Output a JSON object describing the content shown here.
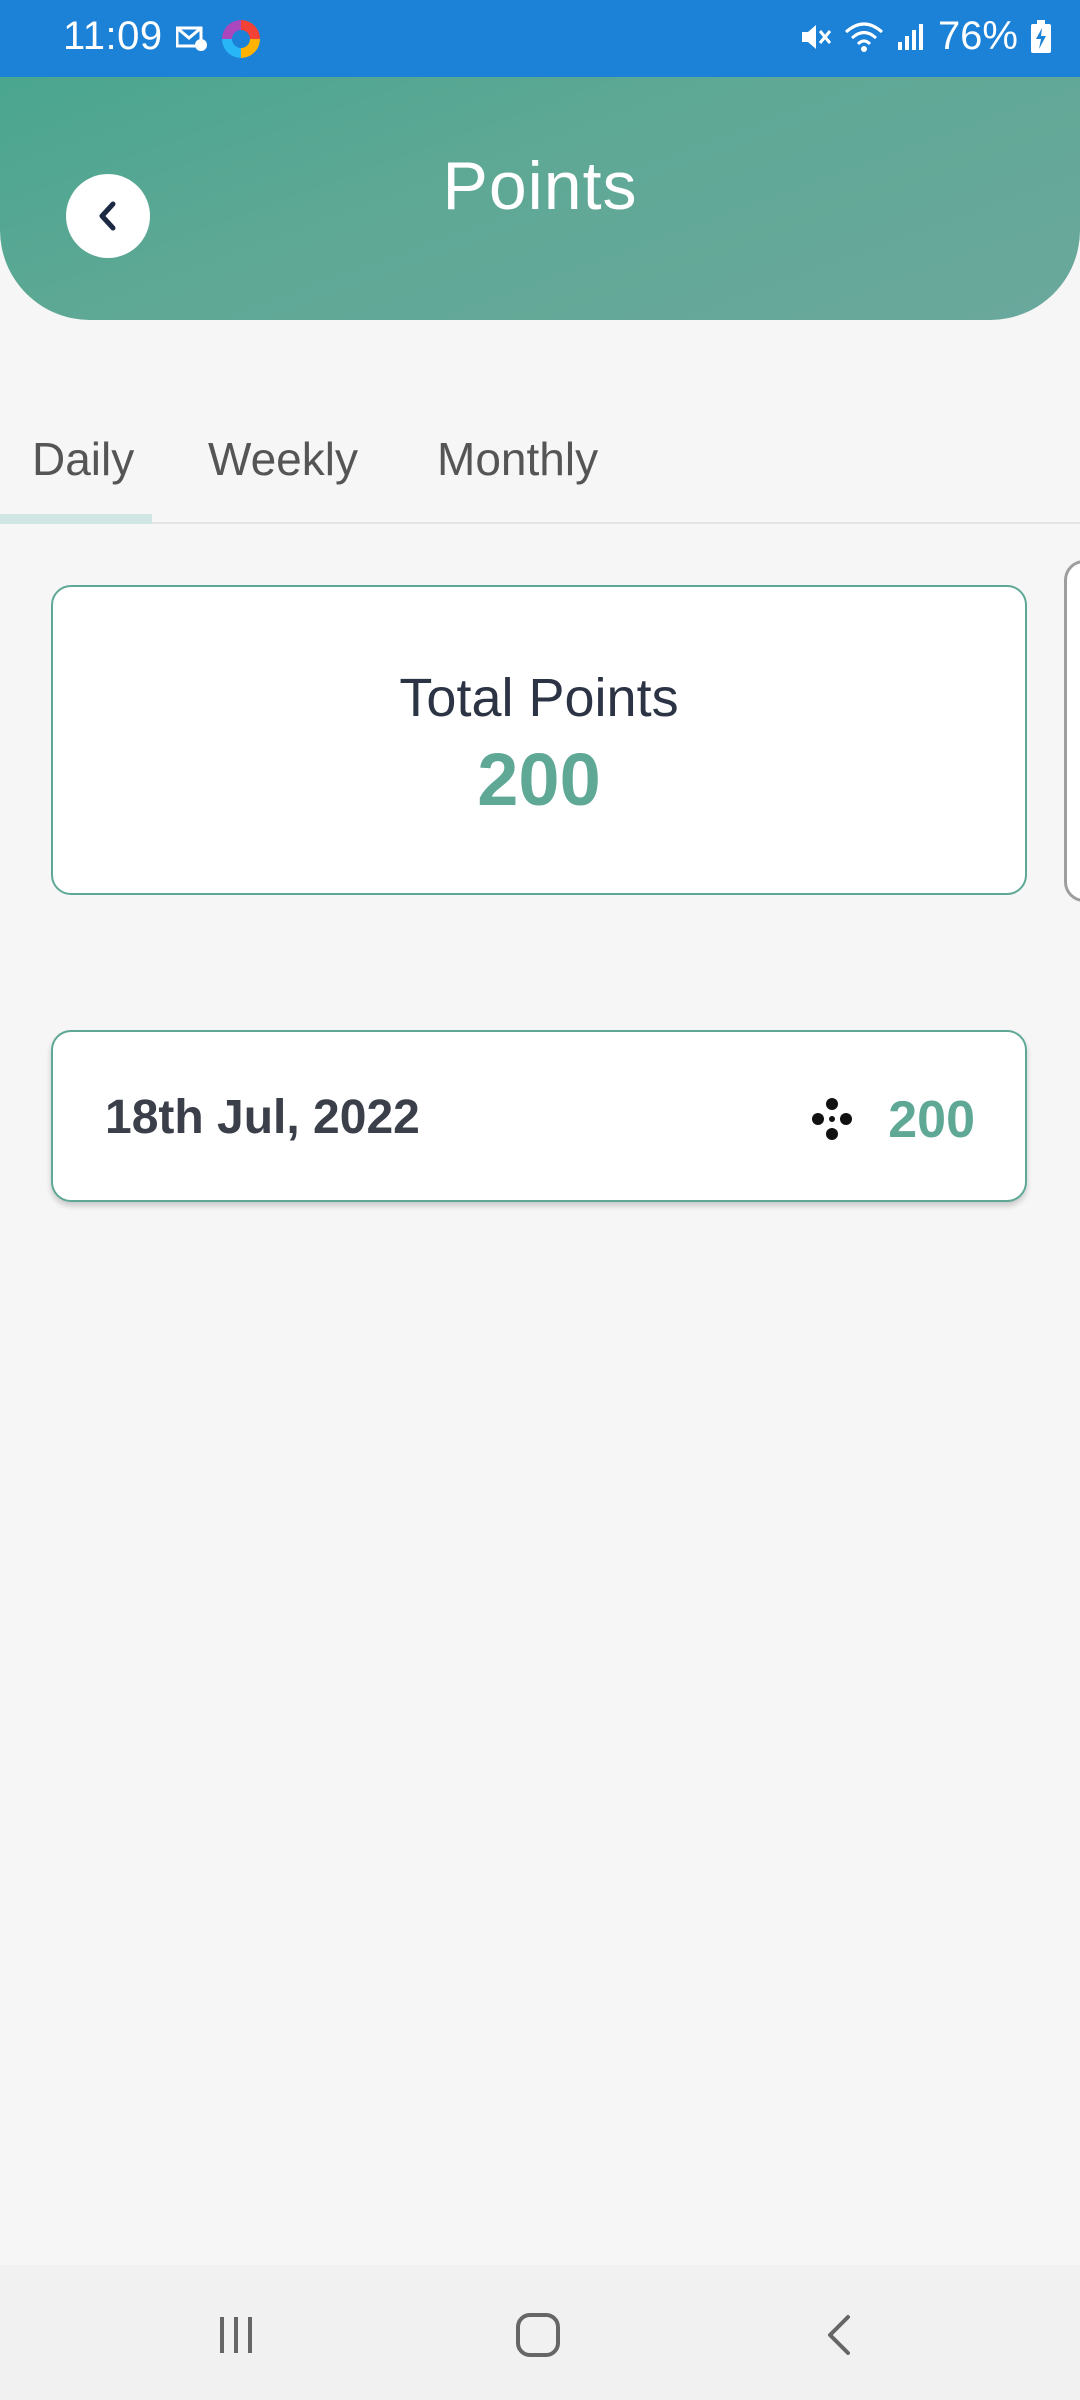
{
  "status_bar": {
    "time": "11:09",
    "battery": "76%",
    "icons": [
      "mail-settings-icon",
      "browser-icon",
      "mute-icon",
      "wifi-icon",
      "signal-icon",
      "battery-charging-icon"
    ]
  },
  "header": {
    "title": "Points",
    "back_icon": "chevron-left-icon"
  },
  "tabs": [
    {
      "label": "Daily",
      "active": true
    },
    {
      "label": "Weekly",
      "active": false
    },
    {
      "label": "Monthly",
      "active": false
    }
  ],
  "summary": {
    "label": "Total Points",
    "value": "200"
  },
  "entries": [
    {
      "date": "18th Jul, 2022",
      "icon": "points-dots-icon",
      "points": "200"
    }
  ],
  "nav_bar": {
    "icons": [
      "recents-icon",
      "home-icon",
      "back-icon"
    ]
  },
  "colors": {
    "status_bar": "#1c82d7",
    "accent": "#5fa896",
    "background": "#f6f6f6"
  }
}
